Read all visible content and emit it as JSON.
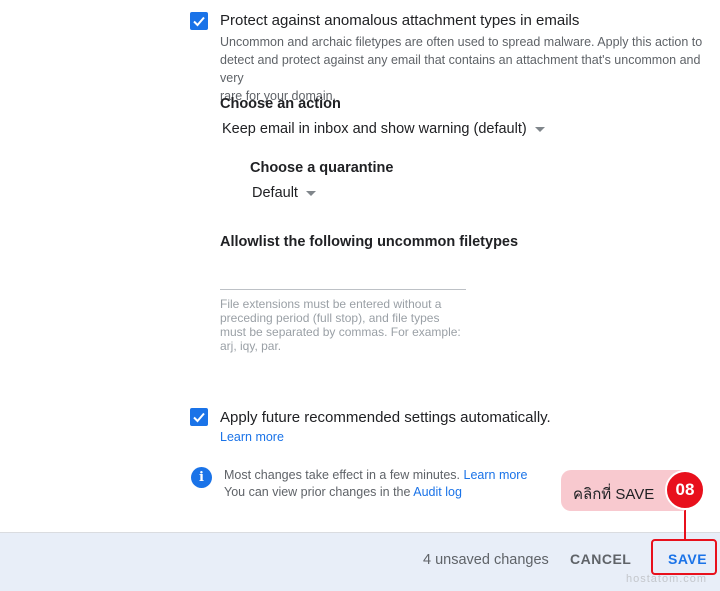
{
  "attachment_setting": {
    "title": "Protect against anomalous attachment types in emails",
    "description_line1": "Uncommon and archaic filetypes are often used to spread malware. Apply this action to",
    "description_line2": "detect and protect against any email that contains an attachment that's uncommon and very",
    "description_line3": "rare for your domain.",
    "checked": true
  },
  "action": {
    "heading": "Choose an action",
    "selected": "Keep email in inbox and show warning (default)"
  },
  "quarantine": {
    "heading": "Choose a quarantine",
    "selected": "Default"
  },
  "allowlist": {
    "heading": "Allowlist the following uncommon filetypes",
    "value": "",
    "hint_line1": "File extensions must be entered without a",
    "hint_line2": "preceding period (full stop), and file types",
    "hint_line3": "must be separated by commas. For example:",
    "hint_line4": "arj, iqy, par."
  },
  "future_settings": {
    "title": "Apply future recommended settings automatically.",
    "learn_more": "Learn more",
    "checked": true
  },
  "info": {
    "line1_text": "Most changes take effect in a few minutes.",
    "line1_link": "Learn more",
    "line2_text": "You can view prior changes in the",
    "line2_link": "Audit log"
  },
  "annotation": {
    "callout_text": "คลิกที่ SAVE",
    "step_number": "08"
  },
  "footer": {
    "unsaved": "4 unsaved changes",
    "cancel_label": "CANCEL",
    "save_label": "SAVE"
  },
  "watermark": "hostatom.com",
  "colors": {
    "accent": "#1a73e8",
    "annotation_red": "#e8101c",
    "callout_bg": "#f8c9cf",
    "footer_bg": "#e8eef8"
  }
}
